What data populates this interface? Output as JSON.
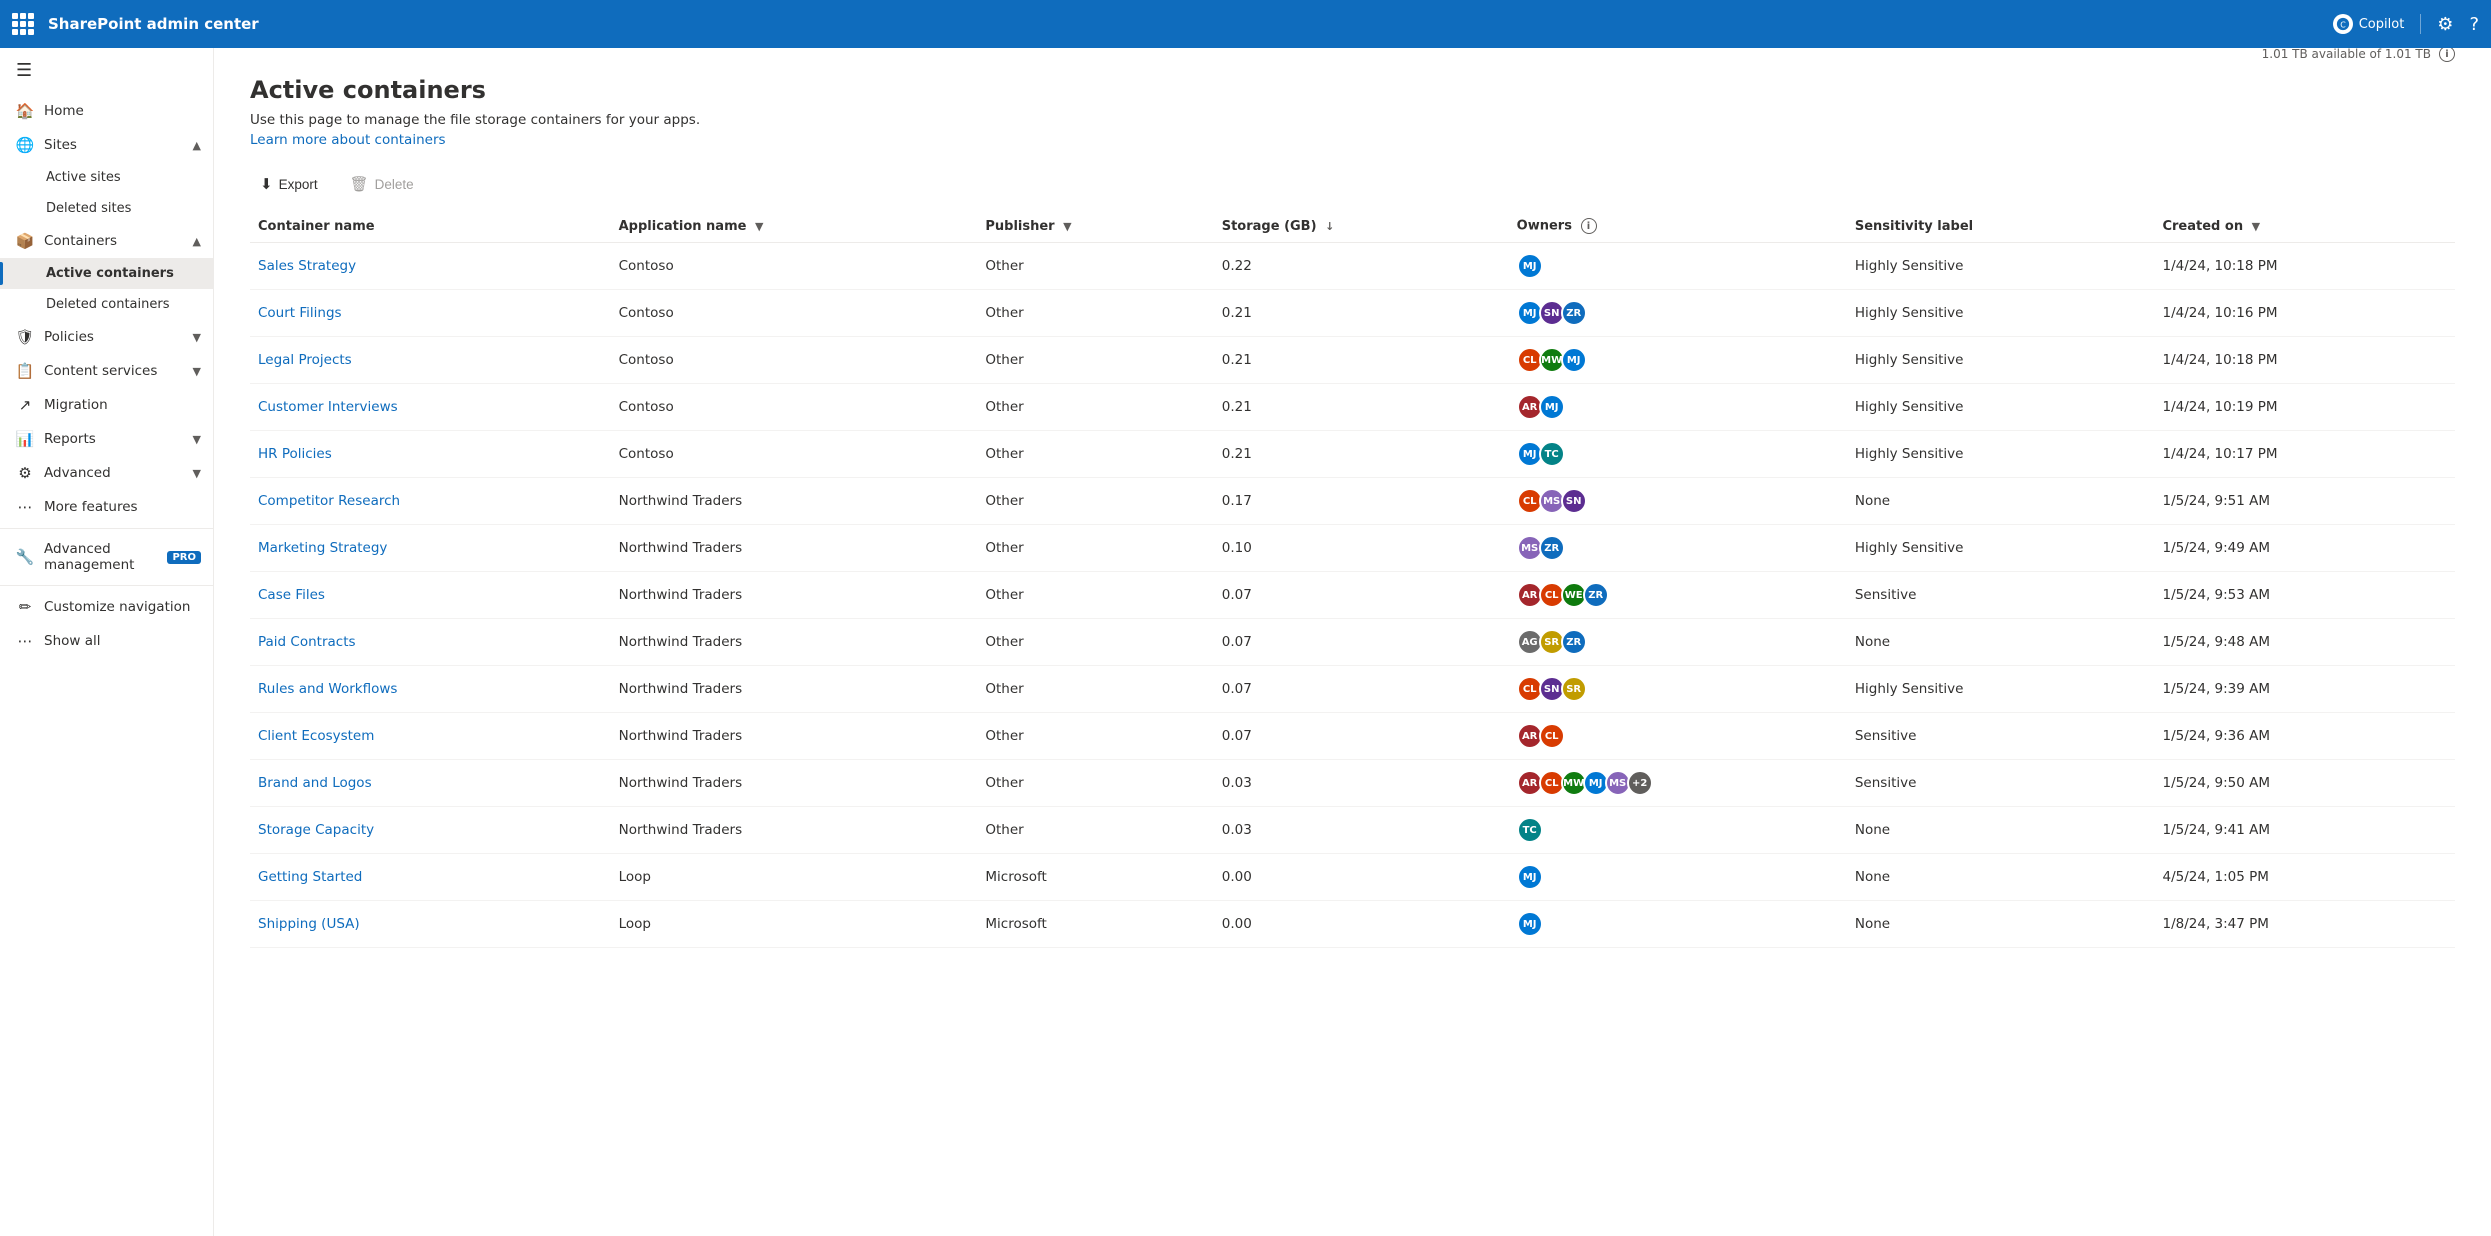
{
  "topbar": {
    "title": "SharePoint admin center",
    "copilot_label": "Copilot",
    "settings_title": "Settings",
    "help_title": "Help"
  },
  "sidebar": {
    "hamburger_label": "Toggle navigation",
    "items": [
      {
        "id": "home",
        "label": "Home",
        "icon": "🏠",
        "level": 0
      },
      {
        "id": "sites",
        "label": "Sites",
        "icon": "🌐",
        "level": 0,
        "expandable": true,
        "expanded": true
      },
      {
        "id": "active-sites",
        "label": "Active sites",
        "icon": "",
        "level": 1
      },
      {
        "id": "deleted-sites",
        "label": "Deleted sites",
        "icon": "",
        "level": 1
      },
      {
        "id": "containers",
        "label": "Containers",
        "icon": "📦",
        "level": 0,
        "expandable": true,
        "expanded": true
      },
      {
        "id": "active-containers",
        "label": "Active containers",
        "icon": "",
        "level": 1,
        "active": true
      },
      {
        "id": "deleted-containers",
        "label": "Deleted containers",
        "icon": "",
        "level": 1
      },
      {
        "id": "policies",
        "label": "Policies",
        "icon": "🛡",
        "level": 0,
        "expandable": true
      },
      {
        "id": "content-services",
        "label": "Content services",
        "icon": "📋",
        "level": 0,
        "expandable": true
      },
      {
        "id": "migration",
        "label": "Migration",
        "icon": "↗",
        "level": 0
      },
      {
        "id": "reports",
        "label": "Reports",
        "icon": "📊",
        "level": 0,
        "expandable": true
      },
      {
        "id": "advanced",
        "label": "Advanced",
        "icon": "⚙",
        "level": 0,
        "expandable": true
      },
      {
        "id": "more-features",
        "label": "More features",
        "icon": "⋯",
        "level": 0
      },
      {
        "id": "advanced-management",
        "label": "Advanced management",
        "icon": "🔧",
        "level": 0,
        "pro": true
      },
      {
        "id": "customize-navigation",
        "label": "Customize navigation",
        "icon": "✏",
        "level": 0
      },
      {
        "id": "show-all",
        "label": "Show all",
        "icon": "⋯",
        "level": 0
      }
    ]
  },
  "page": {
    "title": "Active containers",
    "description": "Use this page to manage the file storage containers for your apps.",
    "learn_more_text": "Learn more about containers",
    "learn_more_url": "#"
  },
  "storage": {
    "available": "1.01 TB available of 1.01 TB",
    "percent": 99.5
  },
  "toolbar": {
    "export_label": "Export",
    "delete_label": "Delete"
  },
  "table": {
    "columns": [
      {
        "id": "name",
        "label": "Container name",
        "sortable": false
      },
      {
        "id": "app",
        "label": "Application name",
        "sortable": true
      },
      {
        "id": "publisher",
        "label": "Publisher",
        "sortable": true
      },
      {
        "id": "storage",
        "label": "Storage (GB)",
        "sortable": true,
        "sorted": true
      },
      {
        "id": "owners",
        "label": "Owners",
        "info": true
      },
      {
        "id": "sensitivity",
        "label": "Sensitivity label"
      },
      {
        "id": "created",
        "label": "Created on",
        "sortable": true
      }
    ],
    "rows": [
      {
        "name": "Sales Strategy",
        "app": "Contoso",
        "publisher": "Other",
        "storage": "0.22",
        "owners": [
          {
            "initials": "MJ",
            "color": "#0078d4"
          }
        ],
        "sensitivity": "Highly Sensitive",
        "created": "1/4/24, 10:18 PM"
      },
      {
        "name": "Court Filings",
        "app": "Contoso",
        "publisher": "Other",
        "storage": "0.21",
        "owners": [
          {
            "initials": "MJ",
            "color": "#0078d4"
          },
          {
            "initials": "SN",
            "color": "#5c2d91"
          },
          {
            "initials": "ZR",
            "color": "#0f6cbd"
          }
        ],
        "sensitivity": "Highly Sensitive",
        "created": "1/4/24, 10:16 PM"
      },
      {
        "name": "Legal Projects",
        "app": "Contoso",
        "publisher": "Other",
        "storage": "0.21",
        "owners": [
          {
            "initials": "CL",
            "color": "#d83b01"
          },
          {
            "initials": "MW",
            "color": "#107c10"
          },
          {
            "initials": "MJ",
            "color": "#0078d4"
          }
        ],
        "sensitivity": "Highly Sensitive",
        "created": "1/4/24, 10:18 PM"
      },
      {
        "name": "Customer Interviews",
        "app": "Contoso",
        "publisher": "Other",
        "storage": "0.21",
        "owners": [
          {
            "initials": "AR",
            "color": "#a4262c"
          },
          {
            "initials": "MJ",
            "color": "#0078d4"
          }
        ],
        "sensitivity": "Highly Sensitive",
        "created": "1/4/24, 10:19 PM"
      },
      {
        "name": "HR Policies",
        "app": "Contoso",
        "publisher": "Other",
        "storage": "0.21",
        "owners": [
          {
            "initials": "MJ",
            "color": "#0078d4"
          },
          {
            "initials": "TC",
            "color": "#038387"
          }
        ],
        "sensitivity": "Highly Sensitive",
        "created": "1/4/24, 10:17 PM"
      },
      {
        "name": "Competitor Research",
        "app": "Northwind Traders",
        "publisher": "Other",
        "storage": "0.17",
        "owners": [
          {
            "initials": "CL",
            "color": "#d83b01"
          },
          {
            "initials": "MS",
            "color": "#8764b8"
          },
          {
            "initials": "SN",
            "color": "#5c2d91"
          }
        ],
        "sensitivity": "None",
        "created": "1/5/24, 9:51 AM"
      },
      {
        "name": "Marketing Strategy",
        "app": "Northwind Traders",
        "publisher": "Other",
        "storage": "0.10",
        "owners": [
          {
            "initials": "MS",
            "color": "#8764b8"
          },
          {
            "initials": "ZR",
            "color": "#0f6cbd"
          }
        ],
        "sensitivity": "Highly Sensitive",
        "created": "1/5/24, 9:49 AM"
      },
      {
        "name": "Case Files",
        "app": "Northwind Traders",
        "publisher": "Other",
        "storage": "0.07",
        "owners": [
          {
            "initials": "AR",
            "color": "#a4262c"
          },
          {
            "initials": "CL",
            "color": "#d83b01"
          },
          {
            "initials": "WE",
            "color": "#0e7a0d"
          },
          {
            "initials": "ZR",
            "color": "#0f6cbd"
          }
        ],
        "sensitivity": "Sensitive",
        "created": "1/5/24, 9:53 AM"
      },
      {
        "name": "Paid Contracts",
        "app": "Northwind Traders",
        "publisher": "Other",
        "storage": "0.07",
        "owners": [
          {
            "initials": "AG",
            "color": "#6b6b6b"
          },
          {
            "initials": "SR",
            "color": "#c19c00"
          },
          {
            "initials": "ZR",
            "color": "#0f6cbd"
          }
        ],
        "sensitivity": "None",
        "created": "1/5/24, 9:48 AM"
      },
      {
        "name": "Rules and Workflows",
        "app": "Northwind Traders",
        "publisher": "Other",
        "storage": "0.07",
        "owners": [
          {
            "initials": "CL",
            "color": "#d83b01"
          },
          {
            "initials": "SN",
            "color": "#5c2d91"
          },
          {
            "initials": "SR",
            "color": "#c19c00"
          }
        ],
        "sensitivity": "Highly Sensitive",
        "created": "1/5/24, 9:39 AM"
      },
      {
        "name": "Client Ecosystem",
        "app": "Northwind Traders",
        "publisher": "Other",
        "storage": "0.07",
        "owners": [
          {
            "initials": "AR",
            "color": "#a4262c"
          },
          {
            "initials": "CL",
            "color": "#d83b01"
          }
        ],
        "sensitivity": "Sensitive",
        "created": "1/5/24, 9:36 AM"
      },
      {
        "name": "Brand and Logos",
        "app": "Northwind Traders",
        "publisher": "Other",
        "storage": "0.03",
        "owners": [
          {
            "initials": "AR",
            "color": "#a4262c"
          },
          {
            "initials": "CL",
            "color": "#d83b01"
          },
          {
            "initials": "MW",
            "color": "#107c10"
          },
          {
            "initials": "MJ",
            "color": "#0078d4"
          },
          {
            "initials": "MS",
            "color": "#8764b8"
          }
        ],
        "extra_owners": 2,
        "sensitivity": "Sensitive",
        "created": "1/5/24, 9:50 AM"
      },
      {
        "name": "Storage Capacity",
        "app": "Northwind Traders",
        "publisher": "Other",
        "storage": "0.03",
        "owners": [
          {
            "initials": "TC",
            "color": "#038387"
          }
        ],
        "sensitivity": "None",
        "created": "1/5/24, 9:41 AM"
      },
      {
        "name": "Getting Started",
        "app": "Loop",
        "publisher": "Microsoft",
        "storage": "0.00",
        "owners": [
          {
            "initials": "MJ",
            "color": "#0078d4"
          }
        ],
        "sensitivity": "None",
        "created": "4/5/24, 1:05 PM"
      },
      {
        "name": "Shipping (USA)",
        "app": "Loop",
        "publisher": "Microsoft",
        "storage": "0.00",
        "owners": [
          {
            "initials": "MJ",
            "color": "#0078d4"
          }
        ],
        "sensitivity": "None",
        "created": "1/8/24, 3:47 PM"
      }
    ]
  }
}
